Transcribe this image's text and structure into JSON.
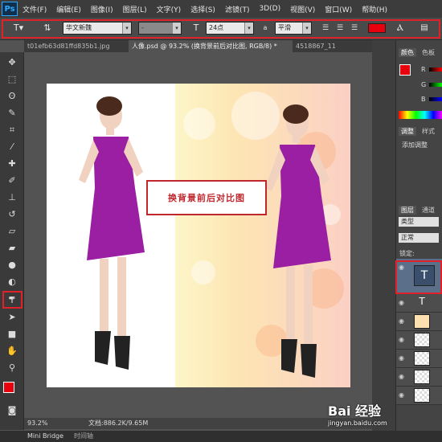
{
  "app": {
    "logo": "Ps"
  },
  "menu": [
    "文件(F)",
    "编辑(E)",
    "图像(I)",
    "图层(L)",
    "文字(Y)",
    "选择(S)",
    "滤镜(T)",
    "3D(D)",
    "视图(V)",
    "窗口(W)",
    "帮助(H)"
  ],
  "options": {
    "font_family": "华文新魏",
    "font_style": "-",
    "font_size": "24点",
    "aa_label": "a",
    "antialias": "平滑",
    "text_color": "#e8000d"
  },
  "tabs": [
    {
      "label": "t01efb63d81ffd835b1.jpg"
    },
    {
      "label": "人像.psd @ 93.2% (换背景前后对比图, RGB/8) *"
    },
    {
      "label": "4518867_11"
    }
  ],
  "canvas": {
    "caption": "换背景前后对比图"
  },
  "status": {
    "zoom": "93.2%",
    "doc": "文档:886.2K/9.65M"
  },
  "bottom": {
    "mini_bridge": "Mini Bridge",
    "timeline": "时间轴"
  },
  "panels": {
    "color_tabs": [
      "颜色",
      "色板"
    ],
    "r_label": "R",
    "g_label": "G",
    "b_label": "B",
    "adjust_tabs": [
      "调整",
      "样式"
    ],
    "add_adjust": "添加调整",
    "layer_tabs": [
      "图层",
      "通道"
    ],
    "kind": "类型",
    "blend": "正常",
    "lock": "锁定:",
    "fg_color": "#e8000d"
  },
  "watermark": {
    "brand": "Bai 经验",
    "url": "jingyan.baidu.com"
  }
}
